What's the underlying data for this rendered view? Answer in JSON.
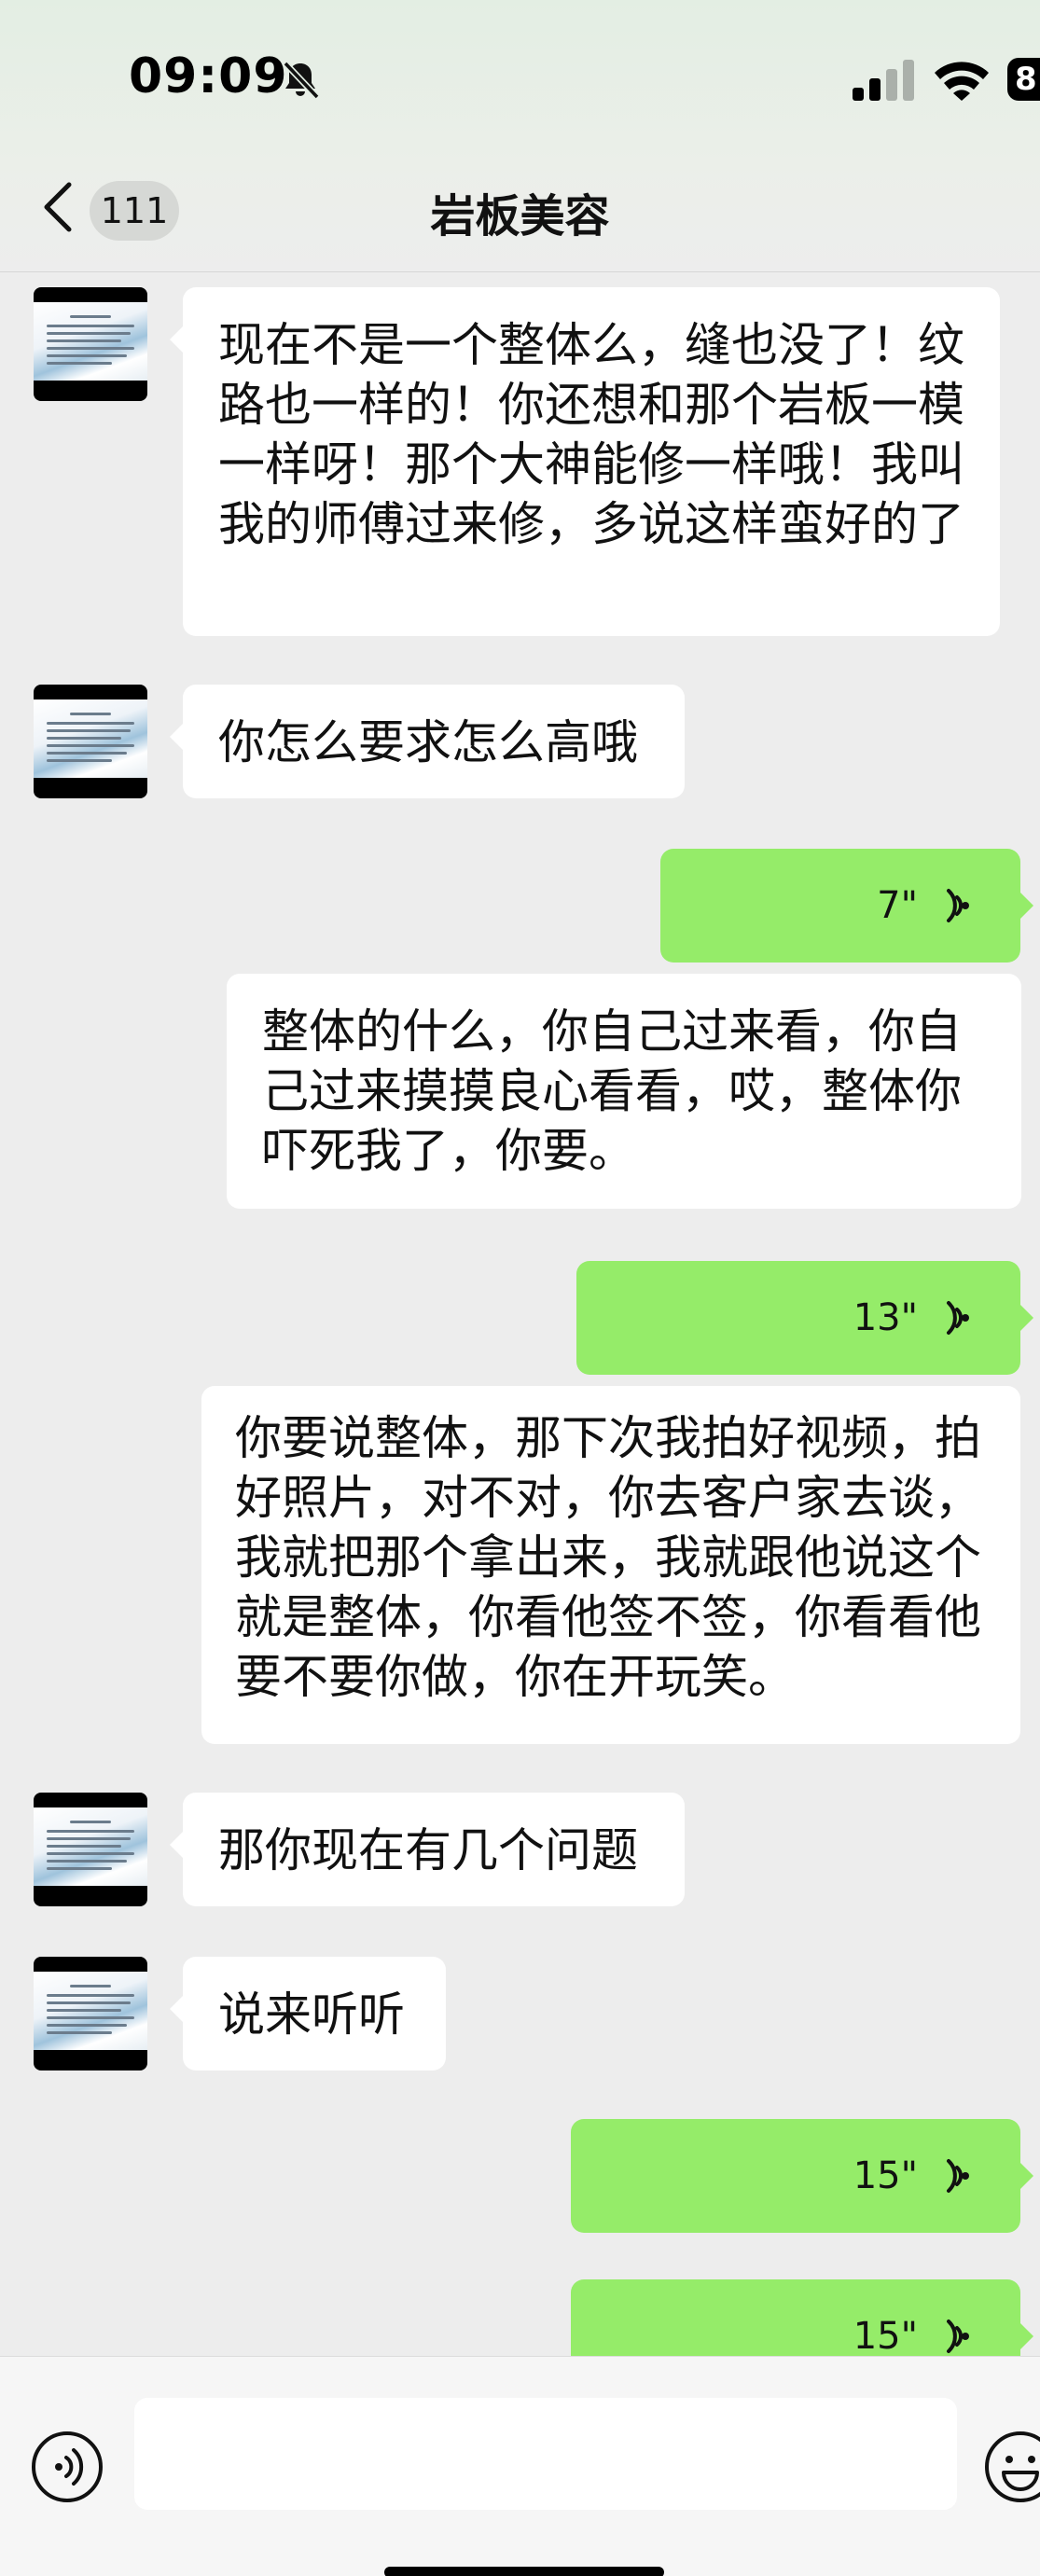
{
  "status_bar": {
    "time": "09:09",
    "battery": "8"
  },
  "header": {
    "unread_count": "111",
    "title": "岩板美容"
  },
  "messages": [
    {
      "side": "left",
      "type": "text",
      "text": "现在不是一个整体么，缝也没了！纹路也一样的！你还想和那个岩板一模一样呀！那个大神能修一样哦！我叫我的师傅过来修，多说这样蛮好的了"
    },
    {
      "side": "left",
      "type": "text",
      "text": "你怎么要求怎么高哦"
    },
    {
      "side": "right",
      "type": "voice",
      "duration": "7\""
    },
    {
      "side": "right",
      "type": "transcription",
      "text": "整体的什么，你自己过来看，你自己过来摸摸良心看看，哎，整体你吓死我了，你要。"
    },
    {
      "side": "right",
      "type": "voice",
      "duration": "13\""
    },
    {
      "side": "right",
      "type": "transcription",
      "text": "你要说整体，那下次我拍好视频，拍好照片，对不对，你去客户家去谈，我就把那个拿出来，我就跟他说这个就是整体，你看他签不签，你看看他要不要你做，你在开玩笑。"
    },
    {
      "side": "left",
      "type": "text",
      "text": "那你现在有几个问题"
    },
    {
      "side": "left",
      "type": "text",
      "text": "说来听听"
    },
    {
      "side": "right",
      "type": "voice",
      "duration": "15\""
    },
    {
      "side": "right",
      "type": "voice",
      "duration": "15\""
    }
  ],
  "colors": {
    "self_bubble": "#95ec69",
    "other_bubble": "#ffffff",
    "background": "#ededed"
  },
  "icons": {
    "back": "chevron-left-icon",
    "mute": "bell-off-icon",
    "voice_input": "voice-input-icon",
    "emoji": "emoji-icon",
    "voice_wave": "voice-wave-icon"
  }
}
